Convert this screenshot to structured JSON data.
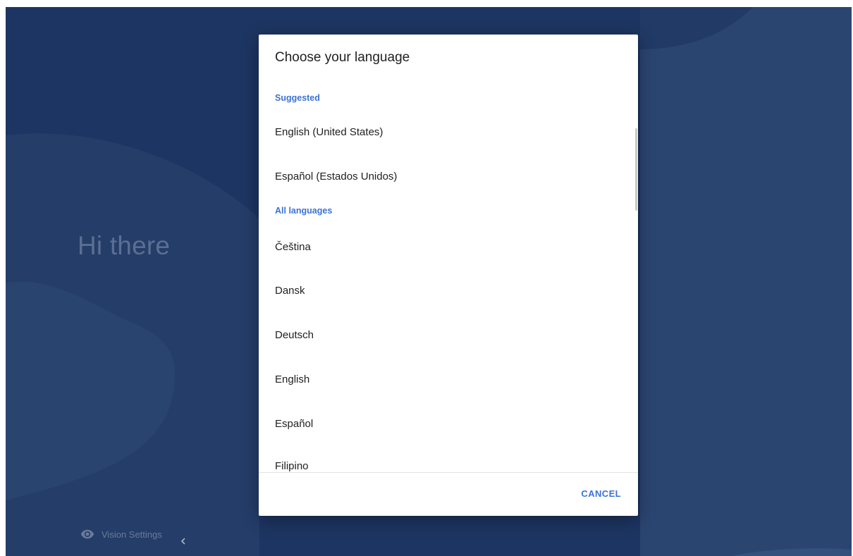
{
  "background": {
    "greeting": "Hi there",
    "vision_settings_label": "Vision Settings",
    "vision_icon": "eye-icon",
    "back_icon": "chevron-left-icon",
    "colors": {
      "base": "#1d3562",
      "wave_light": "#2b4470",
      "greeting_text": "#5c6f91"
    }
  },
  "dialog": {
    "title": "Choose your language",
    "suggested_header": "Suggested",
    "suggested": [
      "English (United States)",
      "Español (Estados Unidos)"
    ],
    "all_header": "All languages",
    "all": [
      "Čeština",
      "Dansk",
      "Deutsch",
      "English",
      "Español",
      "Filipino"
    ],
    "cancel_label": "CANCEL",
    "accent_color": "#3c72d6"
  }
}
